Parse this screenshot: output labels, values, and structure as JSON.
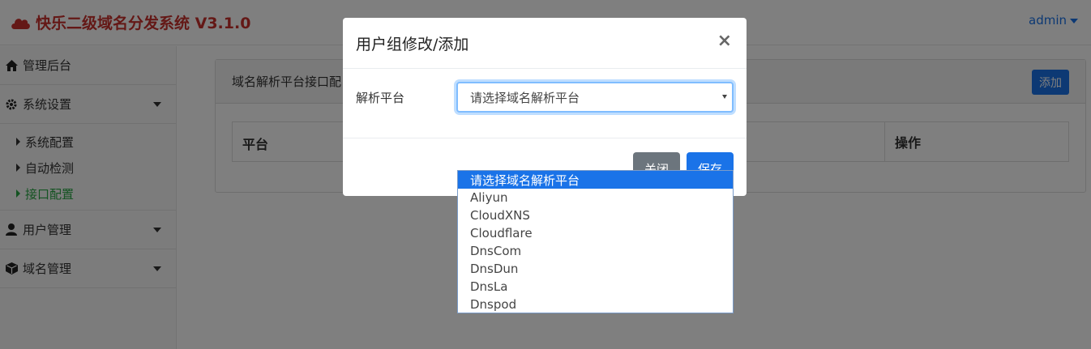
{
  "header": {
    "title": "快乐二级域名分发系统 V3.1.0",
    "user": "admin"
  },
  "sidebar": {
    "items": [
      {
        "label": "管理后台",
        "icon": "home-icon"
      },
      {
        "label": "系统设置",
        "icon": "gear-icon"
      },
      {
        "label": "用户管理",
        "icon": "user-icon"
      },
      {
        "label": "域名管理",
        "icon": "cube-icon"
      }
    ],
    "sub_items": [
      {
        "label": "系统配置"
      },
      {
        "label": "自动检测"
      },
      {
        "label": "接口配置"
      }
    ]
  },
  "panel": {
    "title": "域名解析平台接口配",
    "add_label": "添加",
    "columns": {
      "platform": "平台",
      "actions": "操作"
    }
  },
  "modal": {
    "title": "用户组修改/添加",
    "close_symbol": "×",
    "field_label": "解析平台",
    "select_value": "请选择域名解析平台",
    "close_label": "关闭",
    "save_label": "保存"
  },
  "dropdown": {
    "options": [
      "请选择域名解析平台",
      "Aliyun",
      "CloudXNS",
      "Cloudflare",
      "DnsCom",
      "DnsDun",
      "DnsLa",
      "Dnspod"
    ],
    "selected_index": 0
  },
  "colors": {
    "brand": "#c9302c",
    "primary": "#1a73e8",
    "active_menu": "#28a745",
    "secondary_button": "#6c757d"
  }
}
